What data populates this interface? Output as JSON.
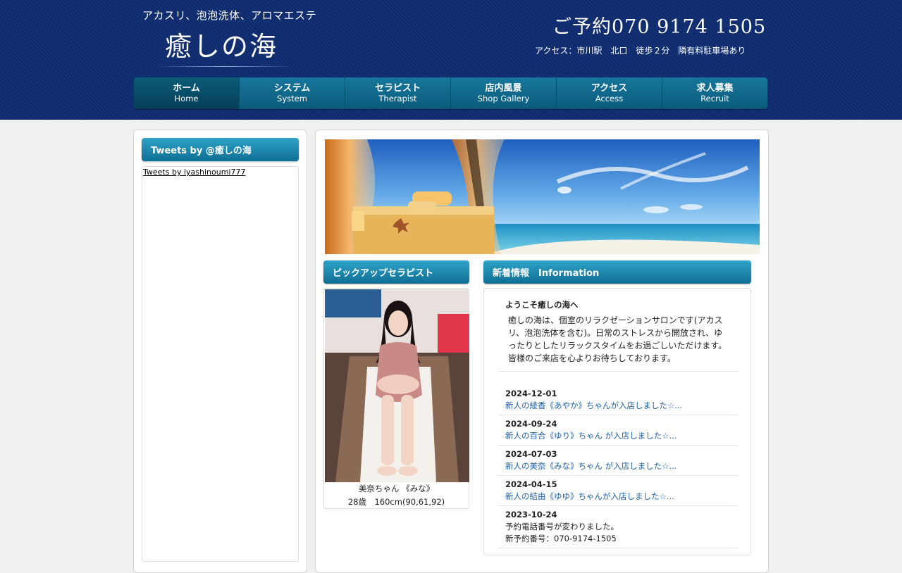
{
  "header": {
    "tagline": "アカスリ、泡泡洗体、アロマエステ",
    "logo": "癒しの海",
    "phone": "ご予約070 9174 1505",
    "access": "アクセス：市川駅　北口　徒歩２分　隣有料駐車場あり"
  },
  "nav": [
    {
      "jp": "ホーム",
      "en": "Home"
    },
    {
      "jp": "システム",
      "en": "System"
    },
    {
      "jp": "セラピスト",
      "en": "Therapist"
    },
    {
      "jp": "店内風景",
      "en": "Shop Gallery"
    },
    {
      "jp": "アクセス",
      "en": "Access"
    },
    {
      "jp": "求人募集",
      "en": "Recruit"
    }
  ],
  "sidebar": {
    "heading": "Tweets by @癒しの海",
    "tweets_link": "Tweets by iyashinoumi777"
  },
  "pickup": {
    "heading": "ピックアップセラピスト",
    "name": "美奈ちゃん 《みな》",
    "stats": "28歳　160cm(90,61,92)"
  },
  "news": {
    "heading": "新着情報　Information",
    "welcome_title": "ようこそ癒しの海へ",
    "welcome_body": "癒しの海は、個室のリラクゼーションサロンです(アカスリ、泡泡洗体を含む)。日常のストレスから開放され、ゆったりとしたリラックスタイムをお過ごしいただけます。皆様のご来店を心よりお待ちしております。",
    "items": [
      {
        "date": "2024-12-01",
        "title": "新人の綾香《あやか》ちゃんが入店しました☆..."
      },
      {
        "date": "2024-09-24",
        "title": "新人の百合《ゆり》ちゃん が入店しました☆..."
      },
      {
        "date": "2024-07-03",
        "title": "新人の美奈《みな》ちゃん が入店しました☆..."
      },
      {
        "date": "2024-04-15",
        "title": "新人の結由《ゆゆ》ちゃんが入店しました☆..."
      },
      {
        "date": "2023-10-24",
        "title": "予約電話番号が変わりました。",
        "extra": "新予約番号：070-9174-1505"
      }
    ]
  },
  "colors": {
    "header_bg": "#0d2a6e",
    "nav_bg": "#0b5a7c",
    "section_head": "#1e8ab0",
    "link": "#1c5fa8"
  }
}
